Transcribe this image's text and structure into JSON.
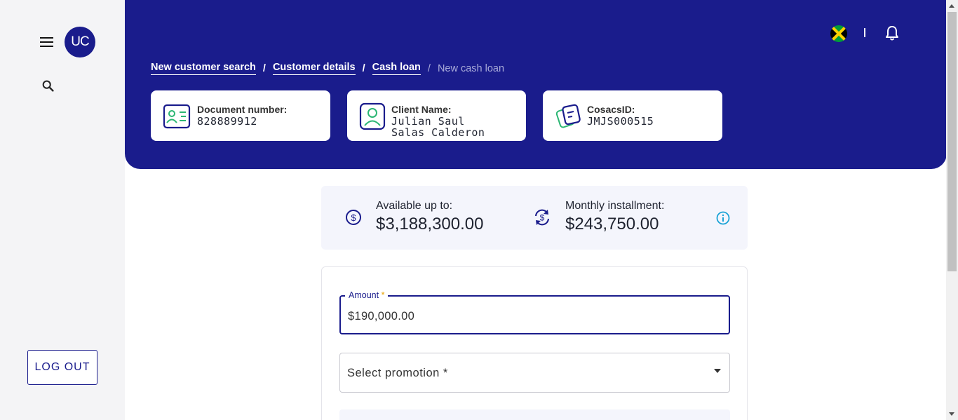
{
  "sidebar": {
    "avatar_initials": "UC",
    "logout_label": "LOG OUT"
  },
  "header": {
    "breadcrumb": [
      {
        "label": "New customer search"
      },
      {
        "label": "Customer details"
      },
      {
        "label": "Cash loan"
      },
      {
        "label": "New cash loan"
      }
    ],
    "separator": "/",
    "country_flag": "jamaica-flag-icon",
    "cards": [
      {
        "icon": "id-card-icon",
        "label": "Document number:",
        "value": "828889912"
      },
      {
        "icon": "user-profile-icon",
        "label": "Client Name:",
        "value": "Julian Saul Salas Calderon"
      },
      {
        "icon": "documents-icon",
        "label": "CosacsID:",
        "value": "JMJS000515"
      }
    ]
  },
  "summary": {
    "available_label": "Available up to:",
    "available_value": "$3,188,300.00",
    "installment_label": "Monthly installment:",
    "installment_value": "$243,750.00"
  },
  "form": {
    "amount_label": "Amount",
    "required_mark": "*",
    "amount_value": "$190,000.00",
    "promotion_placeholder": "Select promotion *"
  },
  "colors": {
    "brand": "#1a1c8c",
    "accent_green": "#2bb673",
    "info_cyan": "#1aa3d6"
  }
}
